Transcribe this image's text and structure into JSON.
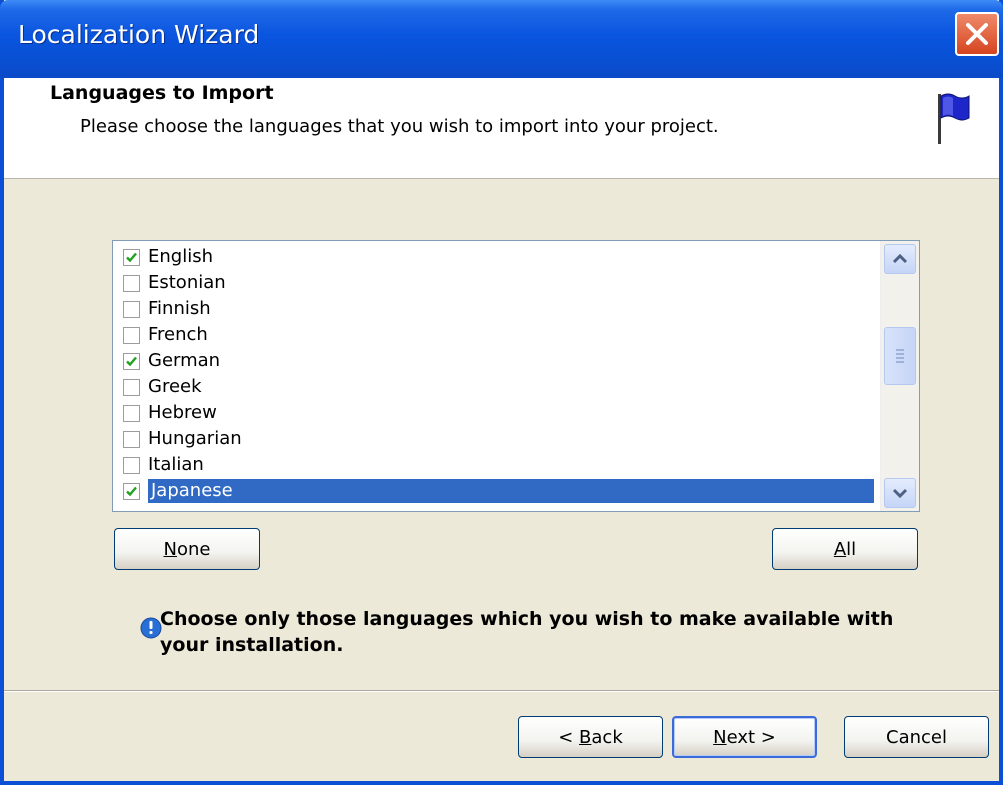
{
  "window": {
    "title": "Localization Wizard"
  },
  "header": {
    "title": "Languages to Import",
    "subtitle": "Please choose the languages that you wish to import into your project."
  },
  "languages": [
    {
      "label": "English",
      "checked": true
    },
    {
      "label": "Estonian",
      "checked": false
    },
    {
      "label": "Finnish",
      "checked": false
    },
    {
      "label": "French",
      "checked": false
    },
    {
      "label": "German",
      "checked": true
    },
    {
      "label": "Greek",
      "checked": false
    },
    {
      "label": "Hebrew",
      "checked": false
    },
    {
      "label": "Hungarian",
      "checked": false
    },
    {
      "label": "Italian",
      "checked": false
    },
    {
      "label": "Japanese",
      "checked": true,
      "selected": true
    }
  ],
  "buttons": {
    "none_prefix": "",
    "none_ul": "N",
    "none_rest": "one",
    "all_prefix": "",
    "all_ul": "A",
    "all_rest": "ll",
    "back_prefix": "< ",
    "back_ul": "B",
    "back_rest": "ack",
    "next_prefix": "",
    "next_ul": "N",
    "next_rest": "ext >",
    "cancel": "Cancel"
  },
  "info": {
    "text": "Choose only those languages which you wish to make available with your installation."
  },
  "icons": {
    "flag": "flag-icon",
    "info": "info-icon",
    "close": "close-icon",
    "scroll_up": "chevron-up-icon",
    "scroll_down": "chevron-down-icon"
  },
  "colors": {
    "titlebar": "#0a55df",
    "selection": "#316ac5",
    "check": "#21a121",
    "close": "#d54420"
  }
}
